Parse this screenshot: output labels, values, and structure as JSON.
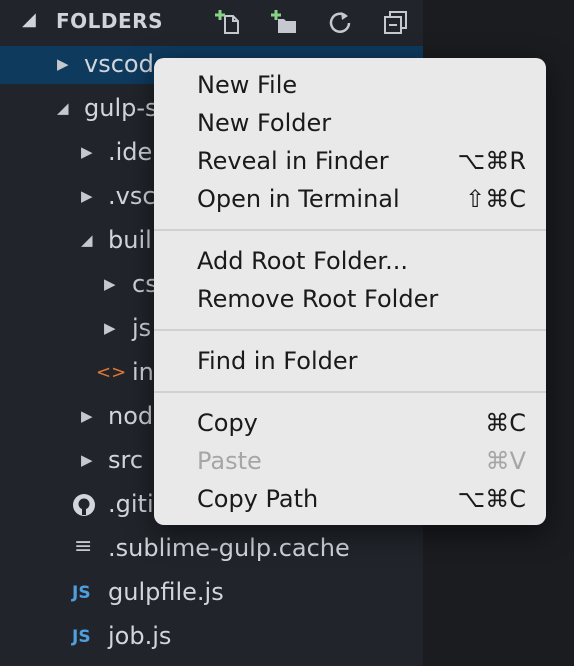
{
  "header": {
    "title": "FOLDERS",
    "icons": [
      "new-file-icon",
      "new-folder-icon",
      "refresh-icon",
      "collapse-all-icon"
    ]
  },
  "tree": [
    {
      "label": "vscode",
      "kind": "folder",
      "state": "collapsed",
      "selected": true
    },
    {
      "label": "gulp-s",
      "kind": "folder",
      "state": "expanded"
    },
    {
      "label": ".ide",
      "kind": "folder",
      "state": "collapsed"
    },
    {
      "label": ".vsc",
      "kind": "folder",
      "state": "collapsed"
    },
    {
      "label": "buil",
      "kind": "folder",
      "state": "expanded"
    },
    {
      "label": "cs",
      "kind": "folder",
      "state": "collapsed"
    },
    {
      "label": "js",
      "kind": "folder",
      "state": "collapsed"
    },
    {
      "label": "in",
      "kind": "file",
      "icon": "html-icon"
    },
    {
      "label": "nod",
      "kind": "folder",
      "state": "collapsed"
    },
    {
      "label": "src",
      "kind": "folder",
      "state": "collapsed"
    },
    {
      "label": ".giti",
      "kind": "file",
      "icon": "github-icon"
    },
    {
      "label": ".sublime-gulp.cache",
      "kind": "file",
      "icon": "lines-icon"
    },
    {
      "label": "gulpfile.js",
      "kind": "file",
      "icon": "js-icon",
      "icon_text": "JS"
    },
    {
      "label": "job.js",
      "kind": "file",
      "icon": "js-icon",
      "icon_text": "JS"
    }
  ],
  "context_menu": {
    "items": [
      {
        "label": "New File",
        "shortcut": ""
      },
      {
        "label": "New Folder",
        "shortcut": ""
      },
      {
        "label": "Reveal in Finder",
        "shortcut": "⌥⌘R"
      },
      {
        "label": "Open in Terminal",
        "shortcut": "⇧⌘C"
      },
      {
        "label": "Add Root Folder...",
        "shortcut": ""
      },
      {
        "label": "Remove Root Folder",
        "shortcut": ""
      },
      {
        "label": "Find in Folder",
        "shortcut": ""
      },
      {
        "label": "Copy",
        "shortcut": "⌘C"
      },
      {
        "label": "Paste",
        "shortcut": "⌘V",
        "disabled": true
      },
      {
        "label": "Copy Path",
        "shortcut": "⌥⌘C"
      }
    ]
  },
  "colors": {
    "sidebar_bg": "#21252b",
    "selection_bg": "#0e3a5e",
    "menu_bg": "#e9e9e9",
    "js_icon": "#4f9edd",
    "html_icon": "#e37933",
    "add_icon_green": "#89d185"
  }
}
